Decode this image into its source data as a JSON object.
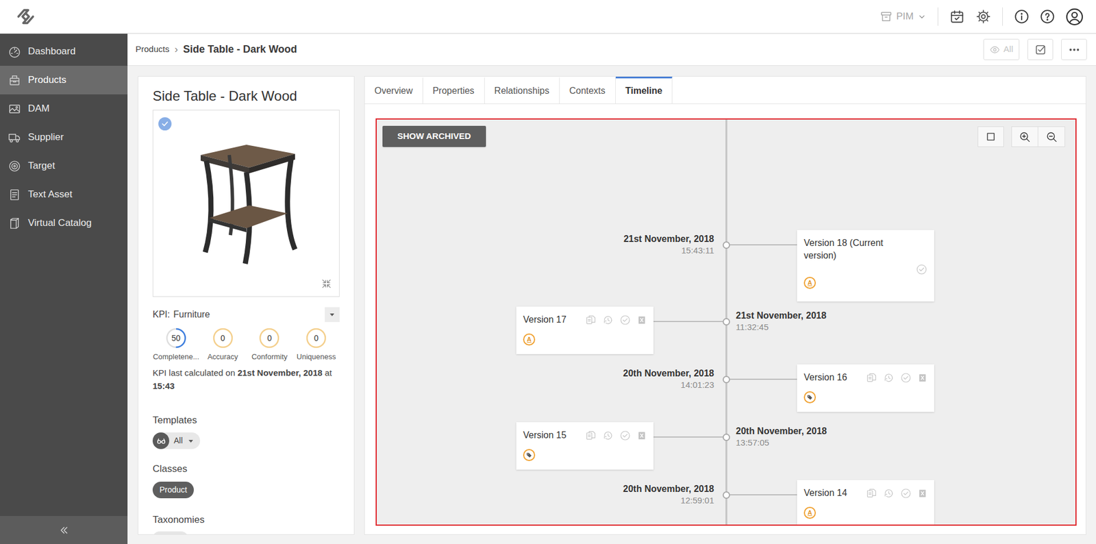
{
  "topbar": {
    "module": "PIM"
  },
  "sidebar": {
    "items": [
      {
        "label": "Dashboard",
        "selected": false
      },
      {
        "label": "Products",
        "selected": true
      },
      {
        "label": "DAM",
        "selected": false
      },
      {
        "label": "Supplier",
        "selected": false
      },
      {
        "label": "Target",
        "selected": false
      },
      {
        "label": "Text Asset",
        "selected": false
      },
      {
        "label": "Virtual Catalog",
        "selected": false
      }
    ]
  },
  "breadcrumb": {
    "items": [
      "Products",
      "Side Table - Dark Wood"
    ],
    "separator": "›"
  },
  "toolbar": {
    "view_filter": "All",
    "view_filter_disabled": true
  },
  "product": {
    "title": "Side Table - Dark Wood",
    "image_selected": true,
    "kpi": {
      "label": "KPI:",
      "profile": "Furniture",
      "metrics": [
        {
          "value": "50",
          "label": "Completene...",
          "level": 0.5
        },
        {
          "value": "0",
          "label": "Accuracy",
          "level": 0
        },
        {
          "value": "0",
          "label": "Conformity",
          "level": 0
        },
        {
          "value": "0",
          "label": "Uniqueness",
          "level": 0
        }
      ],
      "last_calculated": {
        "prefix": "KPI last calculated on ",
        "date": "21st November, 2018",
        "middle": " at ",
        "time": "15:43"
      }
    },
    "templates": {
      "label": "Templates",
      "value": "All"
    },
    "classes": {
      "label": "Classes",
      "items": [
        "Product"
      ]
    },
    "taxonomies": {
      "label": "Taxonomies"
    }
  },
  "tabs": [
    {
      "label": "Overview",
      "selected": false
    },
    {
      "label": "Properties",
      "selected": false
    },
    {
      "label": "Relationships",
      "selected": false
    },
    {
      "label": "Contexts",
      "selected": false
    },
    {
      "label": "Timeline",
      "selected": true
    }
  ],
  "timeline": {
    "show_archived": "SHOW ARCHIVED",
    "versions": [
      {
        "title": "Version 18 (Current version)",
        "date": "21st November, 2018",
        "time": "15:43:11",
        "current": true,
        "change": {
          "kind": "attribute",
          "symbol": "A"
        }
      },
      {
        "title": "Version 17",
        "date": "21st November, 2018",
        "time": "11:32:45",
        "current": false,
        "change": {
          "kind": "attribute",
          "symbol": "A"
        }
      },
      {
        "title": "Version 16",
        "date": "20th November, 2018",
        "time": "14:01:23",
        "current": false,
        "change": {
          "kind": "tag",
          "symbol": ""
        }
      },
      {
        "title": "Version 15",
        "date": "20th November, 2018",
        "time": "13:57:05",
        "current": false,
        "change": {
          "kind": "tag",
          "symbol": ""
        }
      },
      {
        "title": "Version 14",
        "date": "20th November, 2018",
        "time": "12:59:01",
        "current": false,
        "change": {
          "kind": "attribute",
          "symbol": "A"
        }
      }
    ]
  }
}
